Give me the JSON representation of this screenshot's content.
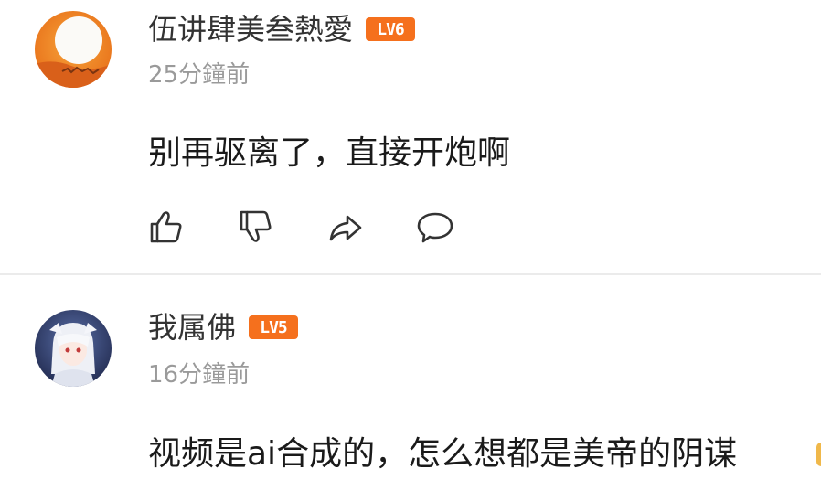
{
  "comments": [
    {
      "username": "伍讲肆美叁熱愛",
      "level": "LV6",
      "timestamp": "25分鐘前",
      "text": "别再驱离了，直接开炮啊",
      "avatar_icon": "sunset-avatar"
    },
    {
      "username": "我属佛",
      "level": "LV5",
      "timestamp": "16分鐘前",
      "text": "视频是ai合成的，怎么想都是美帝的阴谋",
      "avatar_icon": "anime-girl-avatar"
    }
  ],
  "actions": {
    "icons": [
      "thumbs-up-icon",
      "thumbs-down-icon",
      "share-icon",
      "reply-icon"
    ]
  },
  "colors": {
    "level_badge": "#f5701d",
    "timestamp": "#9a9a9a",
    "text": "#1a1a1a",
    "divider": "#ebebeb"
  }
}
